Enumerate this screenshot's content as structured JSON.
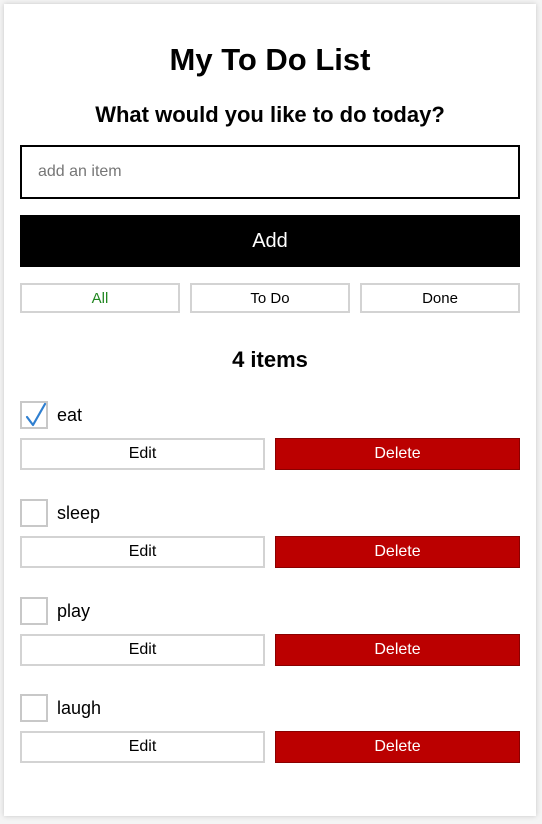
{
  "app": {
    "title": "My To Do List",
    "prompt": "What would you like to do today?"
  },
  "new_item": {
    "placeholder": "add an item",
    "value": ""
  },
  "add_button": {
    "label": "Add"
  },
  "filters": [
    {
      "label": "All",
      "active": true
    },
    {
      "label": "To Do",
      "active": false
    },
    {
      "label": "Done",
      "active": false
    }
  ],
  "count_label": "4 items",
  "todos": [
    {
      "label": "eat",
      "checked": true,
      "edit_label": "Edit",
      "delete_label": "Delete"
    },
    {
      "label": "sleep",
      "checked": false,
      "edit_label": "Edit",
      "delete_label": "Delete"
    },
    {
      "label": "play",
      "checked": false,
      "edit_label": "Edit",
      "delete_label": "Delete"
    },
    {
      "label": "laugh",
      "checked": false,
      "edit_label": "Edit",
      "delete_label": "Delete"
    }
  ],
  "colors": {
    "active_filter": "#218721",
    "delete_button": "#bb0000",
    "checkmark": "#2f7fd0"
  }
}
